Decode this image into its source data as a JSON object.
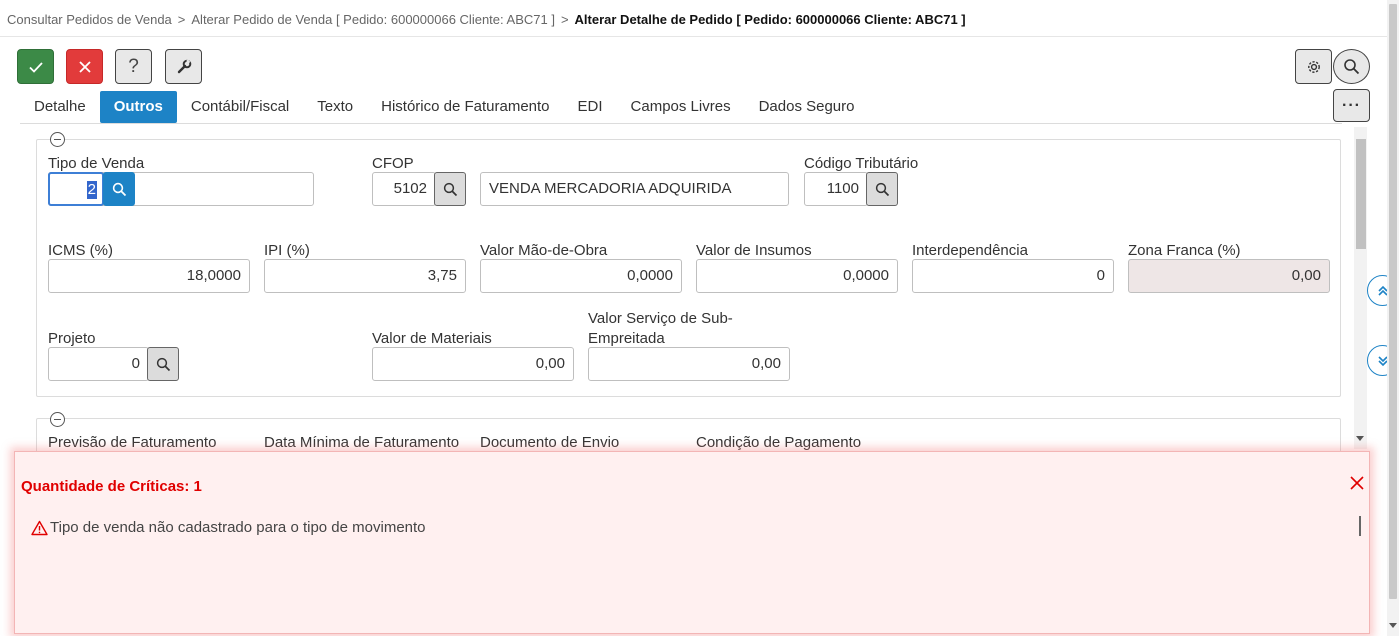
{
  "breadcrumb": {
    "item1": "Consultar Pedidos de Venda",
    "item2": "Alterar Pedido de Venda [ Pedido: 600000066 Cliente: ABC71 ]",
    "current": "Alterar Detalhe de Pedido [ Pedido: 600000066 Cliente: ABC71 ]",
    "separator": ">"
  },
  "toolbar": {
    "confirm_icon": "check-icon",
    "cancel_icon": "close-icon",
    "help_label": "?",
    "tools_icon": "wrench-icon",
    "settings_icon": "gear-icon",
    "search_icon": "search-icon",
    "more_label": "···",
    "colors": {
      "confirm": "#3c8a47",
      "cancel": "#e23b3b",
      "accent": "#1d83c6"
    }
  },
  "tabs": [
    {
      "label": "Detalhe",
      "active": false
    },
    {
      "label": "Outros",
      "active": true
    },
    {
      "label": "Contábil/Fiscal",
      "active": false
    },
    {
      "label": "Texto",
      "active": false
    },
    {
      "label": "Histórico de Faturamento",
      "active": false
    },
    {
      "label": "EDI",
      "active": false
    },
    {
      "label": "Campos Livres",
      "active": false
    },
    {
      "label": "Dados Seguro",
      "active": false
    }
  ],
  "section1": {
    "tipo_venda": {
      "label": "Tipo de Venda",
      "value": "2"
    },
    "cfop": {
      "label": "CFOP",
      "value": "5102",
      "description": "VENDA MERCADORIA ADQUIRIDA"
    },
    "codigo_tributario": {
      "label": "Código Tributário",
      "value": "1100"
    },
    "icms": {
      "label": "ICMS (%)",
      "value": "18,0000"
    },
    "ipi": {
      "label": "IPI (%)",
      "value": "3,75"
    },
    "valor_mao_obra": {
      "label": "Valor Mão-de-Obra",
      "value": "0,0000"
    },
    "valor_insumos": {
      "label": "Valor de Insumos",
      "value": "0,0000"
    },
    "interdependencia": {
      "label": "Interdependência",
      "value": "0"
    },
    "zona_franca": {
      "label": "Zona Franca (%)",
      "value": "0,00"
    },
    "projeto": {
      "label": "Projeto",
      "value": "0"
    },
    "valor_materiais": {
      "label": "Valor de Materiais",
      "value": "0,00"
    },
    "valor_servico_line1": "Valor Serviço de Sub-",
    "valor_servico_line2": "Empreitada",
    "valor_servico_value": "0,00"
  },
  "section2": {
    "previsao_faturamento": "Previsão de Faturamento",
    "data_minima": "Data Mínima de Faturamento",
    "documento_envio": "Documento de Envio",
    "condicao_pagamento": "Condição de Pagamento"
  },
  "errors": {
    "title": "Quantidade de Críticas: 1",
    "messages": [
      "Tipo de venda não cadastrado para o tipo de movimento"
    ],
    "color": "#e00000"
  }
}
